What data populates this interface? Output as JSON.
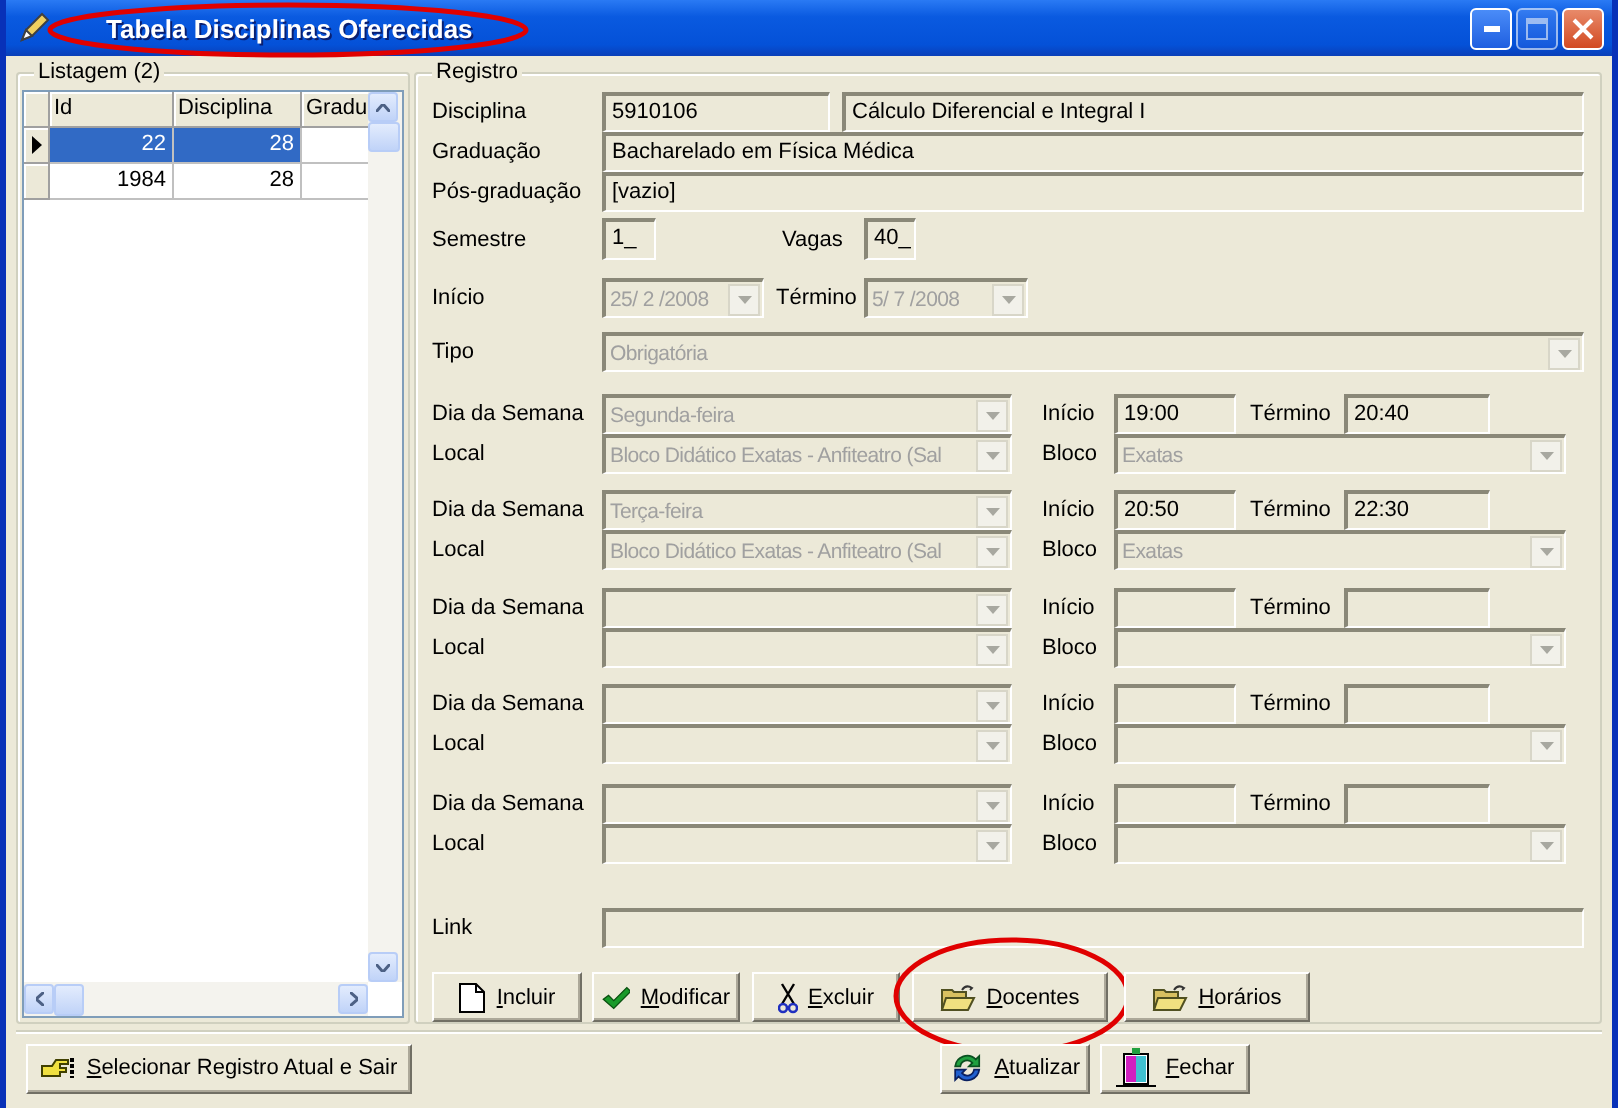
{
  "window": {
    "title": "Tabela Disciplinas Oferecidas"
  },
  "listagem": {
    "title": "Listagem (2)",
    "columns": [
      "Id",
      "Disciplina",
      "Gradu"
    ],
    "rows": [
      {
        "cells": [
          "22",
          "28",
          ""
        ],
        "selected": true
      },
      {
        "cells": [
          "1984",
          "28",
          ""
        ],
        "selected": false
      }
    ]
  },
  "registro": {
    "title": "Registro",
    "combos_disabled": true,
    "disciplina": {
      "label": "Disciplina",
      "code": "5910106",
      "name": "Cálculo Diferencial e Integral I"
    },
    "graduacao": {
      "label": "Graduação",
      "value": "Bacharelado em Física Médica"
    },
    "pos_graduacao": {
      "label": "Pós-graduação",
      "value": "[vazio]"
    },
    "semestre": {
      "label": "Semestre",
      "value": "1_"
    },
    "vagas": {
      "label": "Vagas",
      "value": "40_"
    },
    "inicio": {
      "label": "Início",
      "value": "25/ 2 /2008"
    },
    "termino": {
      "label": "Término",
      "value": "5/ 7 /2008"
    },
    "tipo": {
      "label": "Tipo",
      "value": "Obrigatória"
    },
    "schedules": [
      {
        "dia_label": "Dia da Semana",
        "local_label": "Local",
        "inicio_label": "Início",
        "termino_label": "Término",
        "bloco_label": "Bloco",
        "dia": "Segunda-feira",
        "local": "Bloco Didático Exatas - Anfiteatro (Sal",
        "inicio": "19:00",
        "termino": "20:40",
        "bloco": "Exatas"
      },
      {
        "dia_label": "Dia da Semana",
        "local_label": "Local",
        "inicio_label": "Início",
        "termino_label": "Término",
        "bloco_label": "Bloco",
        "dia": "Terça-feira",
        "local": "Bloco Didático Exatas - Anfiteatro (Sal",
        "inicio": "20:50",
        "termino": "22:30",
        "bloco": "Exatas"
      },
      {
        "dia_label": "Dia da Semana",
        "local_label": "Local",
        "inicio_label": "Início",
        "termino_label": "Término",
        "bloco_label": "Bloco"
      },
      {
        "dia_label": "Dia da Semana",
        "local_label": "Local",
        "inicio_label": "Início",
        "termino_label": "Término",
        "bloco_label": "Bloco"
      },
      {
        "dia_label": "Dia da Semana",
        "local_label": "Local",
        "inicio_label": "Início",
        "termino_label": "Término",
        "bloco_label": "Bloco"
      }
    ],
    "link": {
      "label": "Link"
    },
    "buttons": [
      {
        "label": "Incluir",
        "kind": "new"
      },
      {
        "label": "Modificar",
        "kind": "check"
      },
      {
        "label": "Excluir",
        "kind": "cut"
      },
      {
        "label": "Docentes",
        "kind": "folder",
        "circled": true
      },
      {
        "label": "Horários",
        "kind": "folder",
        "circled": false
      }
    ]
  },
  "footer": {
    "select_button": "Selecionar Registro Atual e Sair",
    "buttons": [
      {
        "label": "Atualizar",
        "kind": "refresh"
      },
      {
        "label": "Fechar",
        "kind": "exit"
      }
    ]
  }
}
